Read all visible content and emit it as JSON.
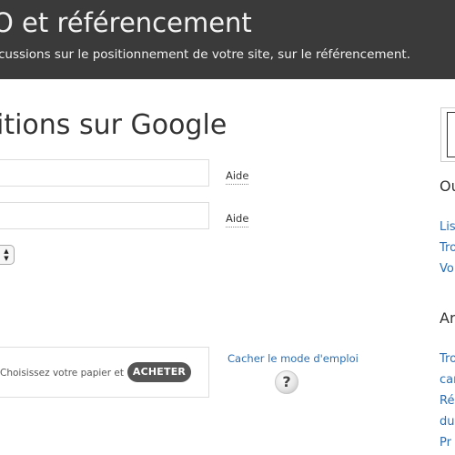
{
  "header": {
    "title": "O et référencement",
    "subtitle": "cussions sur le positionnement de votre site, sur le référencement."
  },
  "main": {
    "heading": "itions sur Google",
    "fields": [
      {
        "value": "",
        "help_label": "Aide"
      },
      {
        "value": "",
        "help_label": "Aide"
      }
    ],
    "product": {
      "text": "Choisissez votre papier et",
      "buy_label": "ACHETER"
    },
    "hide_instructions_label": "Cacher le mode d'emploi",
    "help_icon_glyph": "?"
  },
  "sidebar": {
    "section1_heading": "Ou",
    "section1_links": [
      "Lis",
      "Tro",
      "Vo"
    ],
    "section2_heading": "Ar",
    "section2_links": [
      "Tro",
      "car",
      "Ré",
      "du",
      "Pr"
    ]
  },
  "colors": {
    "header_bg": "#3a3a3a",
    "link": "#2a6fb5",
    "button_bg": "#555555"
  }
}
